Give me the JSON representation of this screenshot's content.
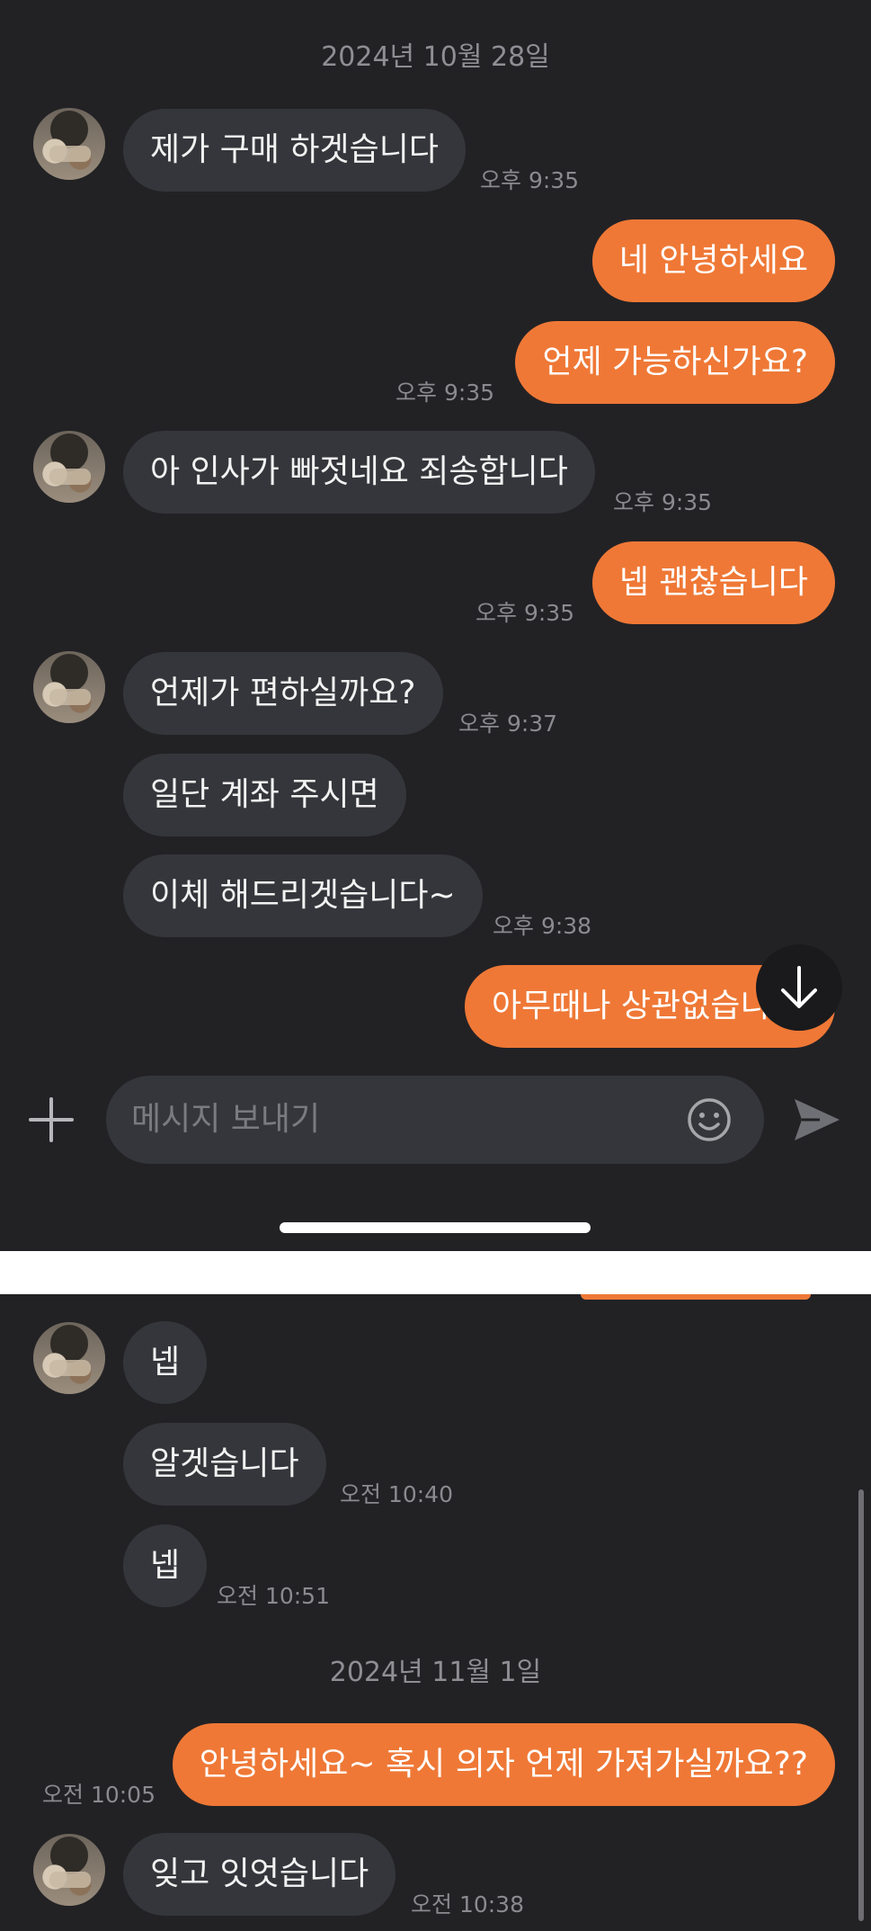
{
  "screen1": {
    "date_header": "2024년 10월 28일",
    "messages": [
      {
        "side": "in",
        "text": "제가 구매 하겟습니다",
        "time": "오후 9:35"
      },
      {
        "side": "out",
        "text": "네 안녕하세요",
        "time": ""
      },
      {
        "side": "out",
        "text": "언제 가능하신가요?",
        "time": "오후 9:35"
      },
      {
        "side": "in",
        "text": "아 인사가 빠젓네요 죄송합니다",
        "time": "오후 9:35"
      },
      {
        "side": "out",
        "text": "넵 괜찮습니다",
        "time": "오후 9:35"
      },
      {
        "side": "in",
        "text": "언제가 편하실까요?",
        "time": "오후 9:37"
      },
      {
        "side": "in",
        "text": "일단 계좌 주시면",
        "time": ""
      },
      {
        "side": "in",
        "text": "이체 해드리겟습니다~",
        "time": "오후 9:38"
      },
      {
        "side": "out",
        "text": "아무때나 상관없습니",
        "time": ""
      }
    ],
    "composer": {
      "placeholder": "메시지 보내기"
    }
  },
  "screen2": {
    "messages": [
      {
        "side": "in",
        "text": "넵",
        "time": ""
      },
      {
        "side": "in",
        "text": "알겟습니다",
        "time": "오전 10:40"
      },
      {
        "side": "in",
        "text": "넵",
        "time": "오전 10:51"
      }
    ],
    "date_header": "2024년 11월 1일",
    "messages_after": [
      {
        "side": "out",
        "text": "안녕하세요~ 혹시 의자 언제 가져가실까요??",
        "time": "오전 10:05"
      },
      {
        "side": "in",
        "text": "잊고 잇엇습니다",
        "time": "오전 10:38"
      }
    ]
  },
  "icons": {
    "add": "plus-icon",
    "emoji": "emoji-icon",
    "send": "send-icon",
    "scroll_down": "arrow-down-icon"
  },
  "colors": {
    "background": "#222225",
    "incoming": "#35363b",
    "outgoing": "#ef7836"
  }
}
